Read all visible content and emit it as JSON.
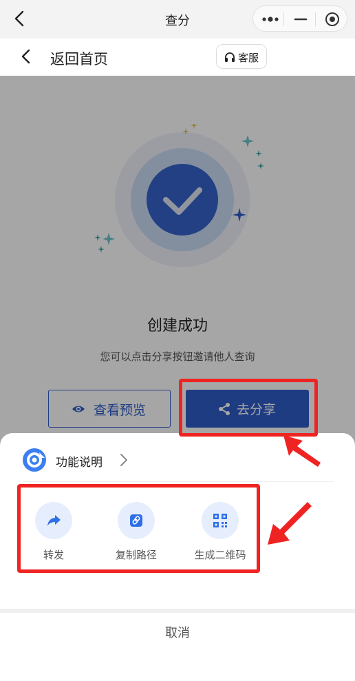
{
  "miniprogram": {
    "title": "查分"
  },
  "header": {
    "title": "返回首页",
    "service_label": "客服"
  },
  "main": {
    "success_title": "创建成功",
    "success_desc": "您可以点击分享按钮邀请他人查询",
    "preview_label": "查看预览",
    "share_label": "去分享"
  },
  "sheet": {
    "feature_label": "功能说明",
    "actions": [
      {
        "label": "转发",
        "icon": "forward-icon"
      },
      {
        "label": "复制路径",
        "icon": "link-icon"
      },
      {
        "label": "生成二维码",
        "icon": "qr-code-icon"
      }
    ],
    "cancel_label": "取消"
  },
  "colors": {
    "primary": "#2f5cc8",
    "annotation": "#f02323",
    "icon_bg": "#e6eefd"
  }
}
